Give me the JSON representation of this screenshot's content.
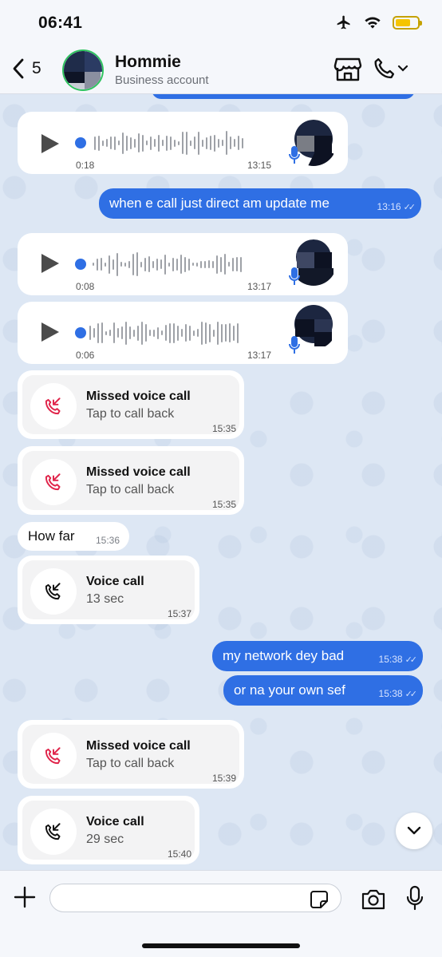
{
  "status_bar": {
    "time": "06:41"
  },
  "header": {
    "back_count": "5",
    "name": "Hommie",
    "subtitle": "Business account"
  },
  "input": {
    "placeholder": ""
  },
  "messages": [
    {
      "type": "voice",
      "direction": "in",
      "duration": "0:18",
      "time": "13:15"
    },
    {
      "type": "text",
      "direction": "out",
      "text": "when e call just direct am update me",
      "time": "13:16"
    },
    {
      "type": "voice",
      "direction": "in",
      "duration": "0:08",
      "time": "13:17"
    },
    {
      "type": "voice",
      "direction": "in",
      "duration": "0:06",
      "time": "13:17"
    },
    {
      "type": "call",
      "direction": "in",
      "title": "Missed voice call",
      "subtitle": "Tap to call back",
      "time": "15:35"
    },
    {
      "type": "call",
      "direction": "in",
      "title": "Missed voice call",
      "subtitle": "Tap to call back",
      "time": "15:35"
    },
    {
      "type": "text",
      "direction": "in",
      "text": "How far",
      "time": "15:36"
    },
    {
      "type": "call",
      "direction": "in",
      "title": "Voice call",
      "subtitle": "13 sec",
      "time": "15:37"
    },
    {
      "type": "text",
      "direction": "out",
      "text": "my network dey bad",
      "time": "15:38"
    },
    {
      "type": "text",
      "direction": "out",
      "text": "or na your own sef",
      "time": "15:38"
    },
    {
      "type": "call",
      "direction": "in",
      "title": "Missed voice call",
      "subtitle": "Tap to call back",
      "time": "15:39"
    },
    {
      "type": "call",
      "direction": "in",
      "title": "Voice call",
      "subtitle": "29 sec",
      "time": "15:40"
    }
  ],
  "colors": {
    "outgoing_bubble": "#2f6fe4",
    "missed_call_icon": "#e0244a",
    "battery": "#f5c400",
    "status_online": "#2ec35f"
  },
  "icons": [
    "airplane-icon",
    "wifi-icon",
    "battery-icon",
    "back-chevron-icon",
    "store-icon",
    "phone-icon",
    "chevron-down-icon",
    "play-icon",
    "microphone-icon",
    "missed-call-icon",
    "incoming-call-icon",
    "plus-icon",
    "sticker-icon",
    "camera-icon",
    "scroll-down-chevron-icon"
  ]
}
